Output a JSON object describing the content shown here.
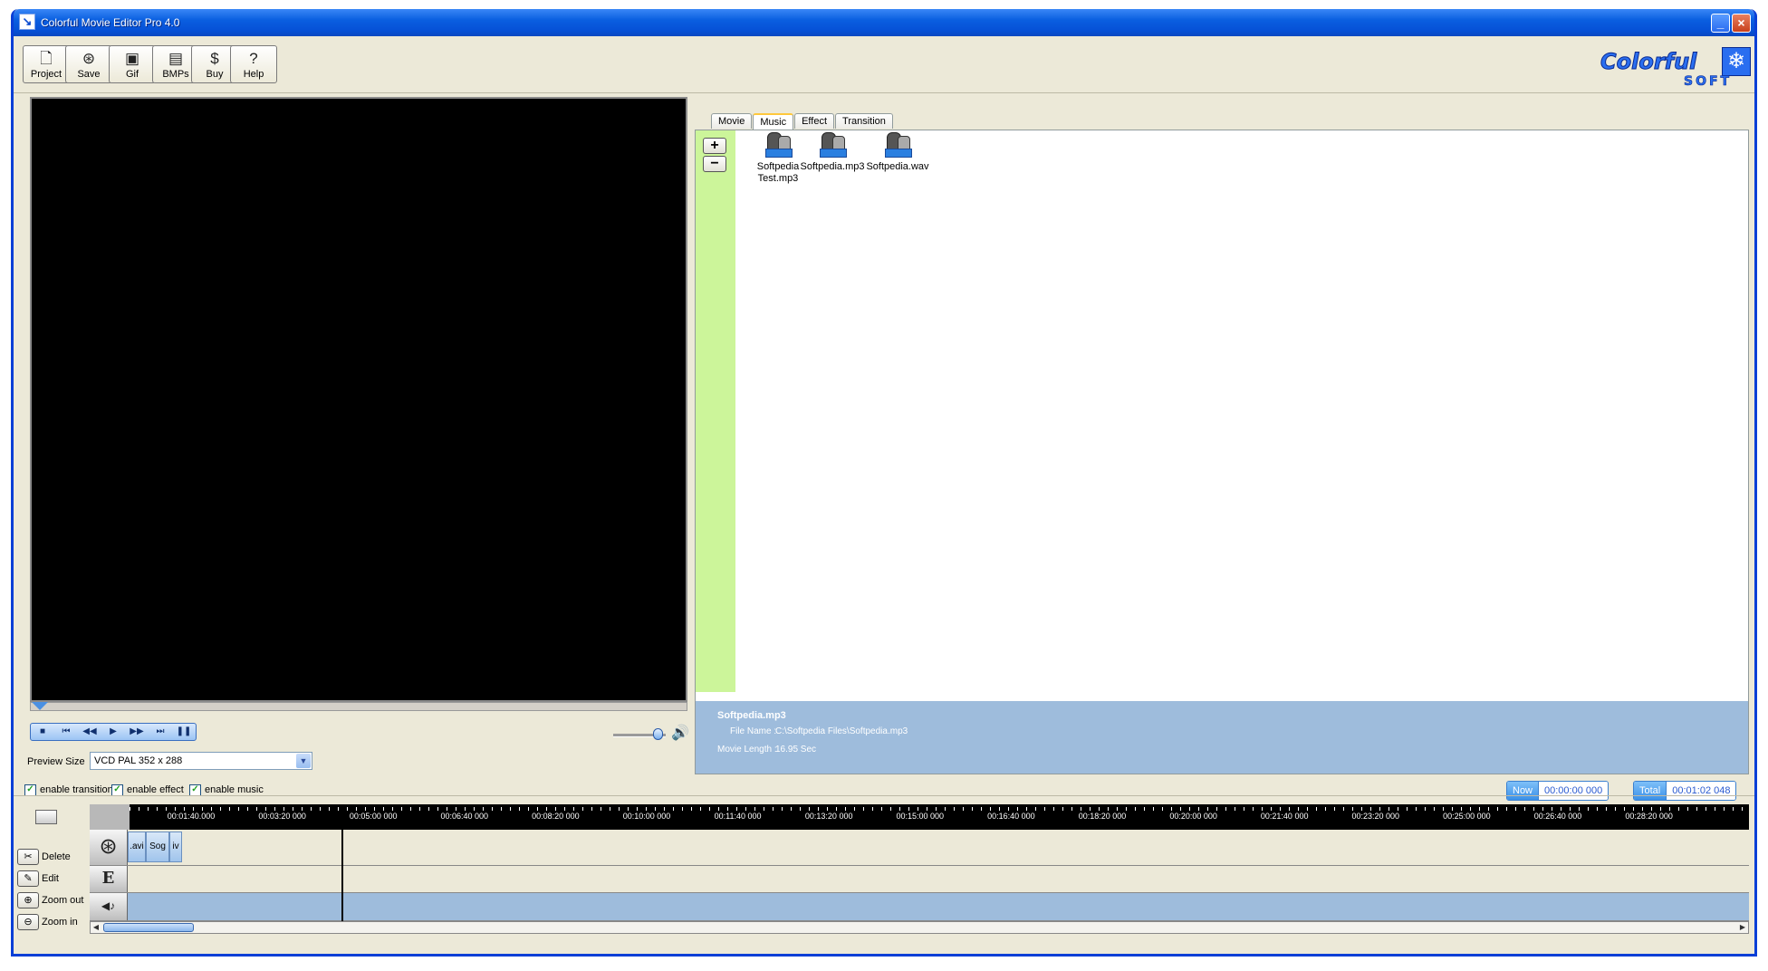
{
  "window": {
    "title": "Colorful Movie Editor Pro 4.0",
    "controls": {
      "minimize": "_",
      "close": "×"
    }
  },
  "toolbar": [
    {
      "id": "project",
      "label": "Project",
      "icon": "document-icon",
      "glyph": "🗋"
    },
    {
      "id": "save",
      "label": "Save",
      "icon": "film-reel-icon",
      "glyph": "⊛"
    },
    {
      "id": "gif",
      "label": "Gif",
      "icon": "gif-icon",
      "glyph": "▣"
    },
    {
      "id": "bmps",
      "label": "BMPs",
      "icon": "image-icon",
      "glyph": "▤"
    },
    {
      "id": "buy",
      "label": "Buy",
      "icon": "dollar-icon",
      "glyph": "$"
    },
    {
      "id": "help",
      "label": "Help",
      "icon": "question-icon",
      "glyph": "?"
    }
  ],
  "logo": {
    "text": "Colorful",
    "sub": "SOFT",
    "glyph": "❄"
  },
  "preview": {
    "transport": [
      "■",
      "⏮",
      "◀◀",
      "▶",
      "▶▶",
      "⏭",
      "❚❚"
    ],
    "speaker_glyph": "🔊",
    "size_label": "Preview Size",
    "size_value": "VCD PAL 352 x 288",
    "size_arrow": "▼"
  },
  "options": [
    {
      "label": "enable transitions",
      "checked": true
    },
    {
      "label": "enable effect",
      "checked": true
    },
    {
      "label": "enable music",
      "checked": true
    }
  ],
  "media": {
    "tabs": [
      {
        "label": "Movie",
        "active": false
      },
      {
        "label": "Music",
        "active": true
      },
      {
        "label": "Effect",
        "active": false
      },
      {
        "label": "Transition",
        "active": false
      }
    ],
    "add_glyph": "+",
    "remove_glyph": "−",
    "files": [
      {
        "line1": "Softpedia",
        "line2": "Test.mp3"
      },
      {
        "line1": "Softpedia.mp3",
        "line2": ""
      },
      {
        "line1": "Softpedia.wav",
        "line2": ""
      }
    ],
    "info": {
      "title": "Softpedia.mp3",
      "file_name_label": "File Name :",
      "file_name": "C:\\Softpedia Files\\Softpedia.mp3",
      "length_label": "Movie Length :",
      "length": "16.95 Sec"
    }
  },
  "timecode": {
    "now_label": "Now",
    "now_value": "00:00:00 000",
    "total_label": "Total",
    "total_value": "00:01:02 048"
  },
  "timeline": {
    "buttons": [
      {
        "label": "Delete",
        "glyph": "✂",
        "icon": "scissors-icon"
      },
      {
        "label": "Edit",
        "glyph": "✎",
        "icon": "edit-icon"
      },
      {
        "label": "Zoom out",
        "glyph": "⊕",
        "icon": "zoom-out-icon"
      },
      {
        "label": "Zoom in",
        "glyph": "⊖",
        "icon": "zoom-in-icon"
      }
    ],
    "ticks": [
      "00:01:40.000",
      "00:03:20 000",
      "00:05:00 000",
      "00:06:40 000",
      "00:08:20 000",
      "00:10:00 000",
      "00:11:40 000",
      "00:13:20 000",
      "00:15:00 000",
      "00:16:40 000",
      "00:18:20 000",
      "00:20:00 000",
      "00:21:40 000",
      "00:23:20 000",
      "00:25:00 000",
      "00:26:40 000",
      "00:28:20 000"
    ],
    "track_icons": {
      "video": "⊛",
      "effect": "E",
      "music": "◀♪"
    },
    "clips": [
      ".avi",
      "Sog",
      "iv"
    ],
    "scroll_left": "◀",
    "scroll_right": "▶"
  }
}
